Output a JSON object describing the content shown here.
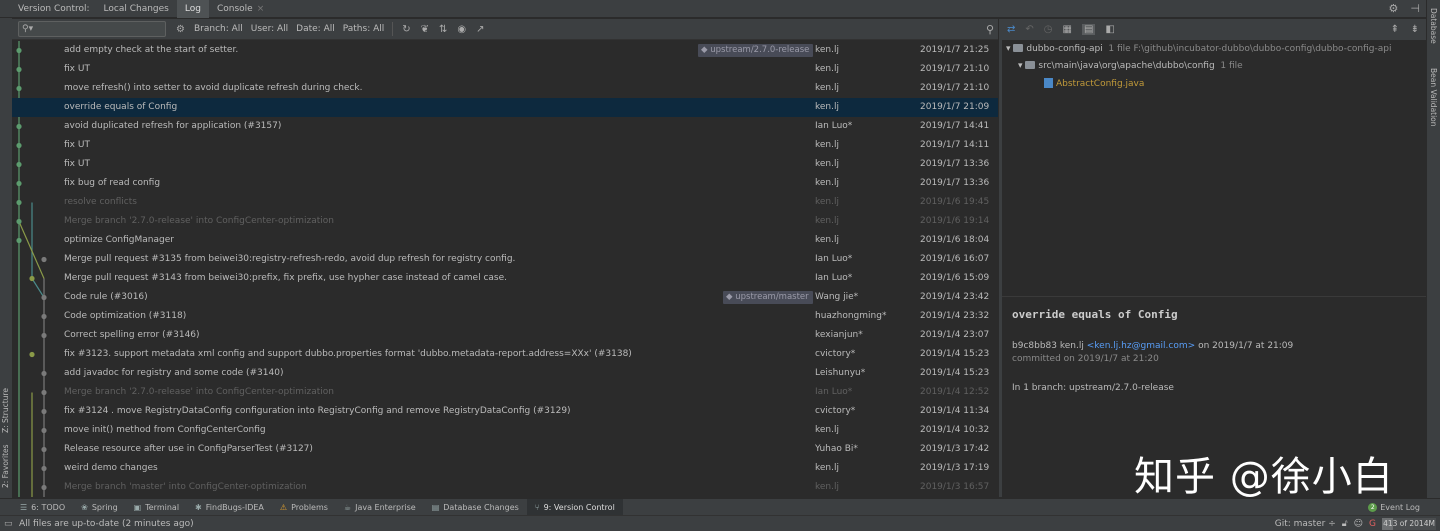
{
  "window": {
    "toolwindow_label": "Version Control:",
    "tabs": [
      {
        "label": "Local Changes",
        "active": false
      },
      {
        "label": "Log",
        "active": true
      },
      {
        "label": "Console",
        "active": false
      }
    ]
  },
  "left_strip": {
    "structure": "Z: Structure",
    "favorites": "2: Favorites"
  },
  "right_strip": {
    "database": "Database",
    "bean_validation": "Bean Validation"
  },
  "log_toolbar": {
    "search_placeholder": "",
    "filters": {
      "branch": "Branch: All",
      "user": "User: All",
      "date": "Date: All",
      "paths": "Paths: All"
    }
  },
  "commits": [
    {
      "message": "add empty check at the start of setter.",
      "tag": "upstream/2.7.0-release",
      "author": "ken.lj",
      "date": "2019/1/7 21:25",
      "dim": false,
      "selected": false
    },
    {
      "message": "fix UT",
      "tag": "",
      "author": "ken.lj",
      "date": "2019/1/7 21:10",
      "dim": false,
      "selected": false
    },
    {
      "message": "move refresh() into setter to avoid duplicate refresh during check.",
      "tag": "",
      "author": "ken.lj",
      "date": "2019/1/7 21:10",
      "dim": false,
      "selected": false
    },
    {
      "message": "override equals of Config",
      "tag": "",
      "author": "ken.lj",
      "date": "2019/1/7 21:09",
      "dim": false,
      "selected": true
    },
    {
      "message": "avoid duplicated refresh for application (#3157)",
      "tag": "",
      "author": "Ian Luo*",
      "date": "2019/1/7 14:41",
      "dim": false,
      "selected": false
    },
    {
      "message": "fix UT",
      "tag": "",
      "author": "ken.lj",
      "date": "2019/1/7 14:11",
      "dim": false,
      "selected": false
    },
    {
      "message": "fix UT",
      "tag": "",
      "author": "ken.lj",
      "date": "2019/1/7 13:36",
      "dim": false,
      "selected": false
    },
    {
      "message": "fix bug of read config",
      "tag": "",
      "author": "ken.lj",
      "date": "2019/1/7 13:36",
      "dim": false,
      "selected": false
    },
    {
      "message": "resolve conflicts",
      "tag": "",
      "author": "ken.lj",
      "date": "2019/1/6 19:45",
      "dim": true,
      "selected": false
    },
    {
      "message": "Merge branch '2.7.0-release' into ConfigCenter-optimization",
      "tag": "",
      "author": "ken.lj",
      "date": "2019/1/6 19:14",
      "dim": true,
      "selected": false
    },
    {
      "message": "optimize ConfigManager",
      "tag": "",
      "author": "ken.lj",
      "date": "2019/1/6 18:04",
      "dim": false,
      "selected": false
    },
    {
      "message": "Merge pull request #3135 from beiwei30:registry-refresh-redo, avoid dup refresh for registry config.",
      "tag": "",
      "author": "Ian Luo*",
      "date": "2019/1/6 16:07",
      "dim": false,
      "selected": false
    },
    {
      "message": "Merge pull request #3143 from beiwei30:prefix, fix prefix, use hypher case instead of camel case.",
      "tag": "",
      "author": "Ian Luo*",
      "date": "2019/1/6 15:09",
      "dim": false,
      "selected": false
    },
    {
      "message": "Code rule (#3016)",
      "tag": "upstream/master",
      "author": "Wang jie*",
      "date": "2019/1/4 23:42",
      "dim": false,
      "selected": false
    },
    {
      "message": "Code optimization (#3118)",
      "tag": "",
      "author": "huazhongming*",
      "date": "2019/1/4 23:32",
      "dim": false,
      "selected": false
    },
    {
      "message": "Correct spelling error (#3146)",
      "tag": "",
      "author": "kexianjun*",
      "date": "2019/1/4 23:07",
      "dim": false,
      "selected": false
    },
    {
      "message": "fix #3123.  support metadata xml config and support dubbo.properties format 'dubbo.metadata-report.address=XXx' (#3138)",
      "tag": "",
      "author": "cvictory*",
      "date": "2019/1/4 15:23",
      "dim": false,
      "selected": false
    },
    {
      "message": "add javadoc for registry and some code (#3140)",
      "tag": "",
      "author": "Leishunyu*",
      "date": "2019/1/4 15:23",
      "dim": false,
      "selected": false
    },
    {
      "message": "Merge branch '2.7.0-release' into ConfigCenter-optimization",
      "tag": "",
      "author": "Ian Luo*",
      "date": "2019/1/4 12:52",
      "dim": true,
      "selected": false
    },
    {
      "message": "fix #3124 . move RegistryDataConfig configuration into RegistryConfig and remove RegistryDataConfig (#3129)",
      "tag": "",
      "author": "cvictory*",
      "date": "2019/1/4 11:34",
      "dim": false,
      "selected": false
    },
    {
      "message": "move init() method from ConfigCenterConfig",
      "tag": "",
      "author": "ken.lj",
      "date": "2019/1/4 10:32",
      "dim": false,
      "selected": false
    },
    {
      "message": "Release resource after use in ConfigParserTest (#3127)",
      "tag": "",
      "author": "Yuhao Bi*",
      "date": "2019/1/3 17:42",
      "dim": false,
      "selected": false
    },
    {
      "message": "weird demo changes",
      "tag": "",
      "author": "ken.lj",
      "date": "2019/1/3 17:19",
      "dim": false,
      "selected": false
    },
    {
      "message": "Merge branch 'master' into ConfigCenter-optimization",
      "tag": "",
      "author": "ken.lj",
      "date": "2019/1/3 16:57",
      "dim": true,
      "selected": false
    }
  ],
  "changes": {
    "root": {
      "name": "dubbo-config-api",
      "meta": "1 file  F:\\github\\incubator-dubbo\\dubbo-config\\dubbo-config-api"
    },
    "package": {
      "name": "src\\main\\java\\org\\apache\\dubbo\\config",
      "meta": "1 file"
    },
    "file": {
      "name": "AbstractConfig.java"
    }
  },
  "details": {
    "title": "override equals of Config",
    "hash_author": "b9c8bb83 ken.lj",
    "email": "<ken.lj.hz@gmail.com>",
    "on_date": "on 2019/1/7 at 21:09",
    "committed": "committed on 2019/1/7 at 21:20",
    "branches": "In 1 branch: upstream/2.7.0-release"
  },
  "watermark": "知乎 @徐小白",
  "bottom_tabs": [
    {
      "label": "6: TODO",
      "icon": "list-icon",
      "active": false
    },
    {
      "label": "Spring",
      "icon": "spring-icon",
      "active": false
    },
    {
      "label": "Terminal",
      "icon": "terminal-icon",
      "active": false
    },
    {
      "label": "FindBugs-IDEA",
      "icon": "bug-icon",
      "active": false
    },
    {
      "label": "Problems",
      "icon": "warning-icon",
      "active": false
    },
    {
      "label": "Java Enterprise",
      "icon": "java-ee-icon",
      "active": false
    },
    {
      "label": "Database Changes",
      "icon": "database-icon",
      "active": false
    },
    {
      "label": "9: Version Control",
      "icon": "vcs-icon",
      "active": true
    }
  ],
  "event_log": {
    "badge": "2",
    "label": "Event Log"
  },
  "status": {
    "message": "All files are up-to-date (2 minutes ago)",
    "git_branch": "Git: master ÷",
    "memory": "413 of 2014M",
    "memory_fraction": 0.21
  },
  "colors": {
    "selected_row": "#0d293e",
    "graph_green": "#5c9b6e",
    "graph_olive": "#8a9a48",
    "graph_teal": "#4a8a8a",
    "graph_gray": "#7a7a7a",
    "link": "#589df6",
    "modified_file": "#c19a3a"
  }
}
